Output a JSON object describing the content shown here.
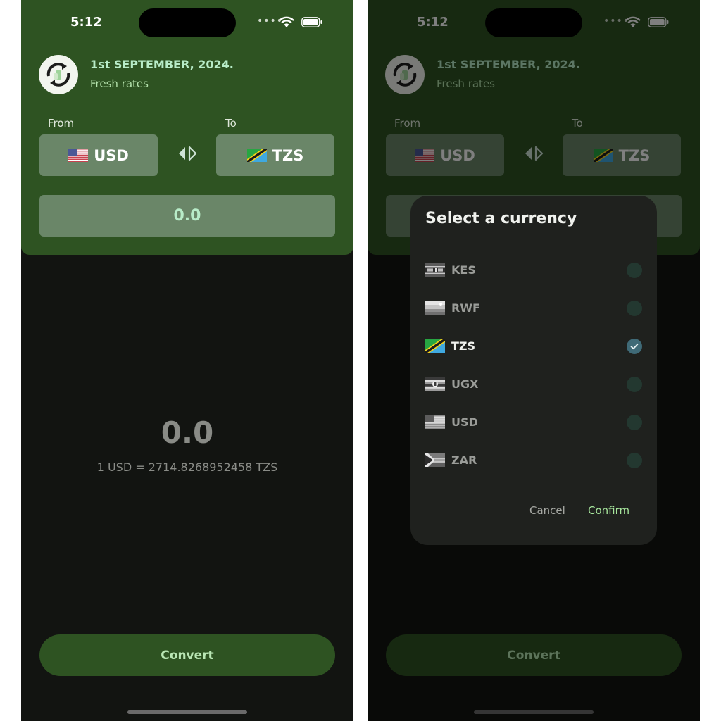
{
  "status": {
    "time": "5:12"
  },
  "header": {
    "date": "1st SEPTEMBER, 2024.",
    "subtitle": "Fresh rates",
    "logo_icon": "currency-refresh-icon"
  },
  "converter": {
    "from_label": "From",
    "to_label": "To",
    "from_code": "USD",
    "to_code": "TZS",
    "amount": "0.0",
    "result": "0.0",
    "rate_text": "1 USD = 2714.8268952458 TZS",
    "convert_label": "Convert"
  },
  "dialog": {
    "title": "Select a currency",
    "options": [
      {
        "code": "KES",
        "selected": false
      },
      {
        "code": "RWF",
        "selected": false
      },
      {
        "code": "TZS",
        "selected": true
      },
      {
        "code": "UGX",
        "selected": false
      },
      {
        "code": "USD",
        "selected": false
      },
      {
        "code": "ZAR",
        "selected": false
      }
    ],
    "cancel_label": "Cancel",
    "confirm_label": "Confirm"
  },
  "colors": {
    "header_green": "#2e5322",
    "field_green": "#6a8668",
    "accent_mint": "#b8ecc8",
    "confirm_green": "#a6e59c",
    "background": "#121411"
  }
}
